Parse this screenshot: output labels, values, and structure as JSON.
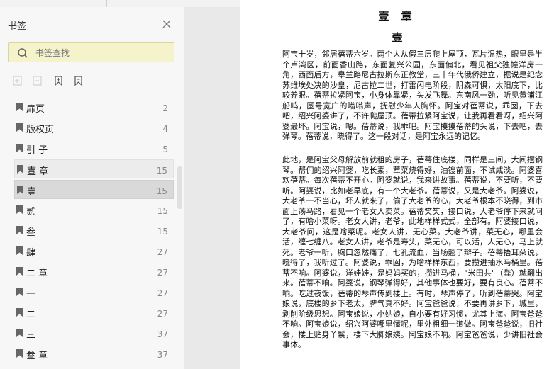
{
  "sidebar": {
    "title": "书签",
    "search_placeholder": "书签查找",
    "items": [
      {
        "label": "扉页",
        "page": "2"
      },
      {
        "label": "版权页",
        "page": "4"
      },
      {
        "label": "引 子",
        "page": "5"
      },
      {
        "label": "壹 章",
        "page": "15"
      },
      {
        "label": "壹",
        "page": "15"
      },
      {
        "label": "贰",
        "page": "15"
      },
      {
        "label": "叁",
        "page": "15"
      },
      {
        "label": "肆",
        "page": "27"
      },
      {
        "label": "二 章",
        "page": "27"
      },
      {
        "label": "一",
        "page": "27"
      },
      {
        "label": "二",
        "page": "27"
      },
      {
        "label": "三",
        "page": "37"
      },
      {
        "label": "叁 章",
        "page": "37"
      }
    ]
  },
  "document": {
    "chapter_title": "壹 章",
    "section_title": "壹",
    "paragraphs": [
      "阿宝十岁，邻居蓓蒂六岁。两个人从假三层爬上屋顶，瓦片温热，眼里是半个卢湾区，前面香山路，东面复兴公园，东面偏北，看见祖父独幢洋房一角，西面后方，皋兰路尼古拉斯东正教堂，三十年代俄侨建立，据说是纪念苏维埃处决的沙皇，尼古拉二世，打雷闪电阶段，阴森可惧，太阳底下，比较养眼。蓓蒂拉紧阿宝，小身体靠紧，头发飞舞。东南风一劲，听见黄浦江船鸣，圆号宽广的嗡嗡声，抚慰少年人胸怀。阿宝对蓓蒂说，乖囡，下去吧，绍兴阿婆讲了，不许爬屋顶。蓓蒂拉紧阿宝说，让我再看看呀，绍兴阿婆最坏。阿宝说，嗯。蓓蒂说，我乖吧。阿宝摸摸蓓蒂的头说，下去吧，去弹琴。蓓蒂说，晓得了。这一段对话，是阿宝永远的记忆。",
      "此地，是阿宝父母解放前就租的房子，蓓蒂住底楼，同样是三间，大间摆钢琴。帮佣的绍兴阿婆，吃长素，荤菜烧得好，油锼前面，不试咸淡。阿婆喜欢蓓蒂。每次蓓蒂不开心。阿婆就说，我来讲故事。蓓蒂说，不要听，不要听。阿婆说，比如老早底，有一个大老爷。蓓蒂说，又是大老爷。阿婆说，大老爷一不当心，坏人就来了，偷了大老爷的心，大老爷根本不晓得，到市面上荡马路，看见一个老女人卖菜。蓓蒂笑笑，接口说，大老爷停下来就问了，有啥小菜呀。老女人讲，老爷，此地样样式式，全部有。阿婆接口说，大老爷问，这是啥菜呢。老女人讲，无心菜。大老爷讲，菜无心，哪里会活，缠七缠八。老女人讲，老爷是寿头，菜无心，可以活，人无心，马上就死。老爷一听，胸口忽然痛了，七孔流血，当场翘了辫子。蓓蒂捂耳朵说，晓得了，我听过了。阿婆说，乖囡，为啥样样东西，要攒进抽水马桶里。蓓蒂不响。阿婆说，洋娃娃，是妈妈买的，攒进马桶，\"米田共\"（粪）就翻出来。蓓蒂不响。阿婆说，钢琴弹得好，其他事体也要好，要有良心。蓓蒂不响。吃过夜饭，蓓蒂的琴声传到楼上。有时，琴声停了，听到蓓蒂哭。阿宝娘说，底楼的乡下老太，脾气真不好。阿宝爸爸说，不要再讲乡下，城里，剥削阶级思想。阿宝娘说，小姑娘，自小要有好习惯，尤其上海。阿宝爸爸不响。阿宝娘说，绍兴阿婆哪里懂呢，里外粗细一道做。阿宝爸爸说，旧社会，楼上贴身丫鬟，楼下大脚娘姨。阿宝娘不响。阿宝爸爸说，少讲旧社会事体。"
    ]
  },
  "icons": {
    "close": "close-icon",
    "search": "search-icon",
    "bookmark": "bookmark-icon"
  },
  "colors": {
    "search_bg": "#f5f3c9",
    "selected_row": "#d9d9d9",
    "sidebar_bg": "#f7f7f7",
    "page_bg": "#ffffff"
  }
}
